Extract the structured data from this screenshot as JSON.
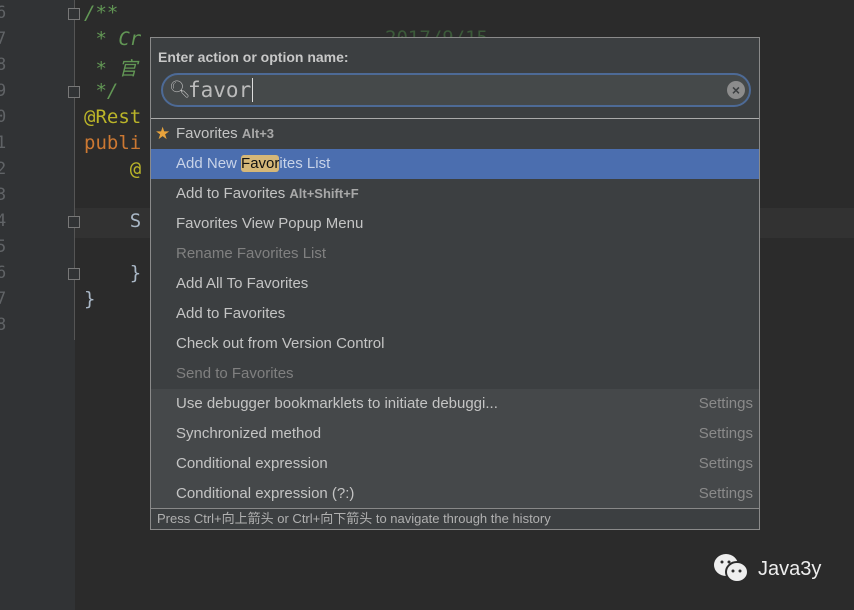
{
  "editor": {
    "line_numbers": [
      "6",
      "7",
      "8",
      "9",
      "0",
      "1",
      "2",
      "3",
      "4",
      "5",
      "6",
      "7",
      "8"
    ],
    "code_lines": [
      {
        "text": "/**",
        "color": "#629755"
      },
      {
        "text": " * Cr",
        "color": "#629755"
      },
      {
        "text": " * 官",
        "color": "#629755"
      },
      {
        "text": " */",
        "color": "#629755"
      },
      {
        "text": "@Rest",
        "color": "#bbb529"
      },
      {
        "text": "publi",
        "color": "#cc7832"
      },
      {
        "text": "    @",
        "color": "#bbb529"
      },
      {
        "text": "",
        "color": "#a9b7c6"
      },
      {
        "text": "    S",
        "color": "#a9b7c6"
      },
      {
        "text": "",
        "color": "#a9b7c6"
      },
      {
        "text": "    }",
        "color": "#a9b7c6"
      },
      {
        "text": "}",
        "color": "#a9b7c6"
      }
    ],
    "behind_popup_date": "2017/9/15"
  },
  "popup": {
    "title": "Enter action or option name:",
    "search_value": "favor",
    "items": [
      {
        "label": "Favorites",
        "shortcut": "Alt+3",
        "icon": "star-icon",
        "state": "normal",
        "group": 1
      },
      {
        "pre": "Add New ",
        "match": "Favor",
        "post": "ites List",
        "state": "selected",
        "group": 1
      },
      {
        "label": "Add to Favorites",
        "shortcut": "Alt+Shift+F",
        "state": "normal",
        "group": 1
      },
      {
        "label": "Favorites View Popup Menu",
        "state": "normal",
        "group": 1
      },
      {
        "label": "Rename Favorites List",
        "state": "disabled",
        "group": 1
      },
      {
        "label": "Add All To Favorites",
        "state": "normal",
        "group": 1
      },
      {
        "label": "Add to Favorites",
        "state": "normal",
        "group": 1
      },
      {
        "label": "Check out from Version Control",
        "state": "normal",
        "group": 1
      },
      {
        "label": "Send to Favorites",
        "state": "disabled",
        "group": 1
      },
      {
        "label": "Use debugger bookmarklets to initiate debuggi...",
        "right": "Settings",
        "group": 2
      },
      {
        "label": "Synchronized method",
        "right": "Settings",
        "group": 2
      },
      {
        "label": "Conditional expression",
        "right": "Settings",
        "group": 2
      },
      {
        "label": "Conditional expression (?:)",
        "right": "Settings",
        "group": 2
      }
    ],
    "footer": "Press Ctrl+向上箭头 or Ctrl+向下箭头 to navigate through the history"
  },
  "watermark": {
    "text": "Java3y",
    "icon": "wechat-icon"
  },
  "colors": {
    "selection": "#4b6eaf",
    "highlight": "#d5b778",
    "popup_bg": "#3c3f41"
  }
}
